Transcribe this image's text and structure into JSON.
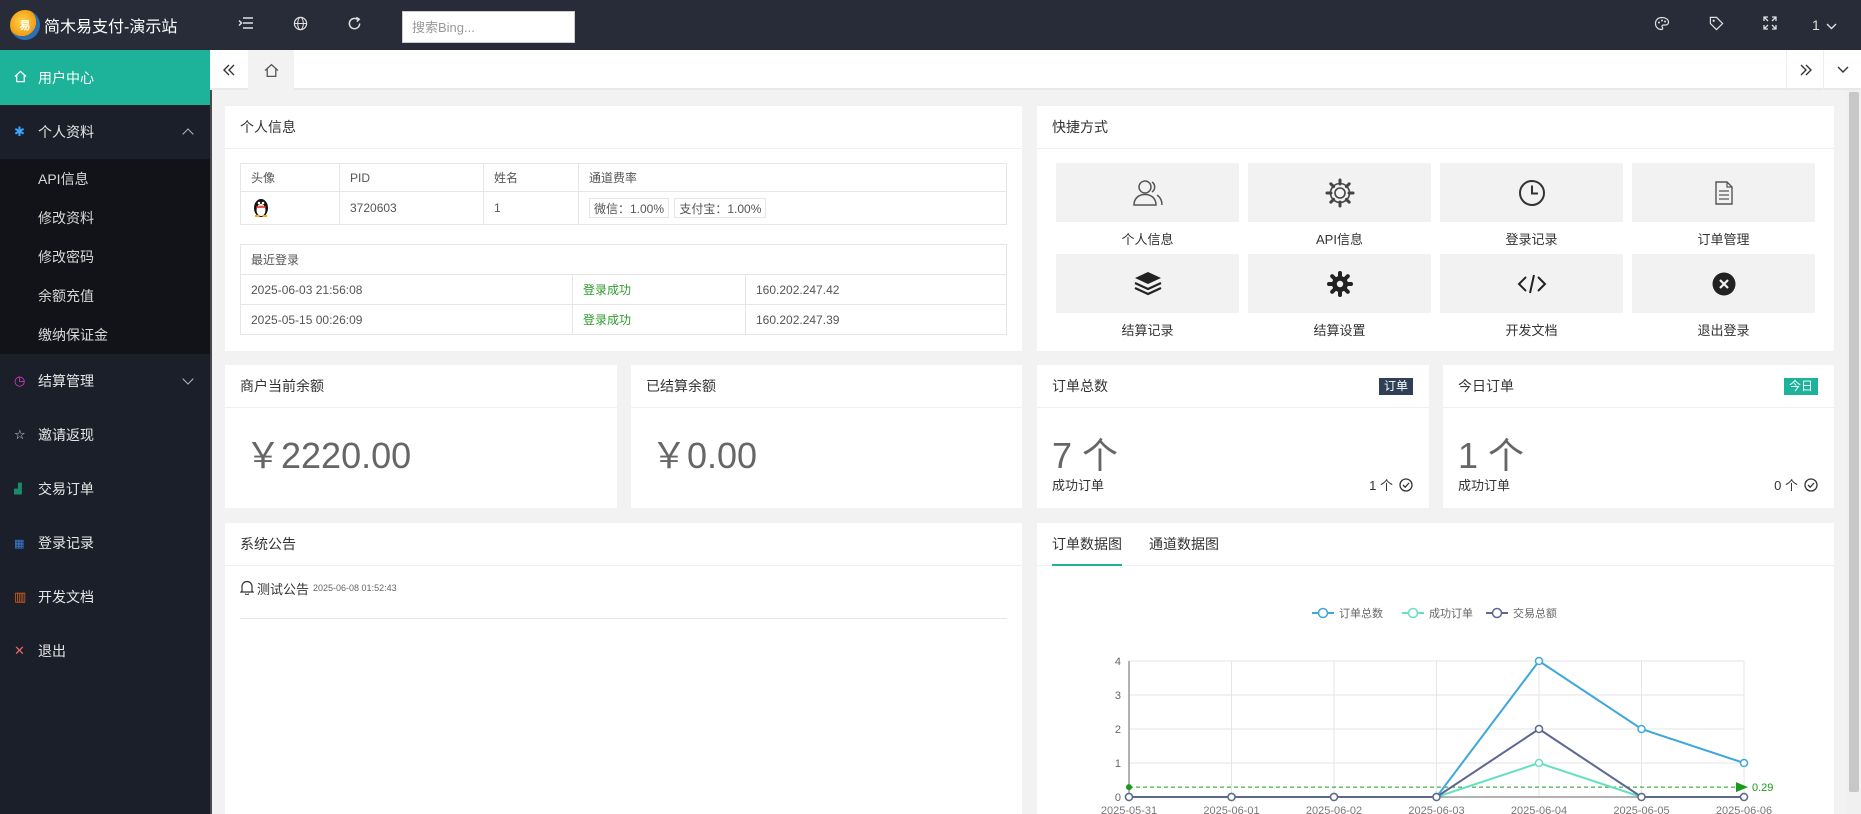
{
  "brand": {
    "name": "简木易支付-演示站",
    "logo_text": "易"
  },
  "sidebar": {
    "user_center": "用户中心",
    "profile": "个人资料",
    "profile_sub": [
      "API信息",
      "修改资料",
      "修改密码",
      "余额充值",
      "缴纳保证金"
    ],
    "settlement": "结算管理",
    "invite": "邀请返现",
    "orders": "交易订单",
    "login_log": "登录记录",
    "dev_docs": "开发文档",
    "logout": "退出"
  },
  "topbar": {
    "search_placeholder": "搜索Bing...",
    "user_label": "1"
  },
  "personal": {
    "title": "个人信息",
    "headers": [
      "头像",
      "PID",
      "姓名",
      "通道费率"
    ],
    "pid": "3720603",
    "name": "1",
    "rates": [
      "微信：1.00%",
      "支付宝：1.00%"
    ],
    "recent_login_title": "最近登录",
    "logins": [
      {
        "time": "2025-06-03 21:56:08",
        "status": "登录成功",
        "ip": "160.202.247.42"
      },
      {
        "time": "2025-05-15 00:26:09",
        "status": "登录成功",
        "ip": "160.202.247.39"
      }
    ]
  },
  "shortcuts": {
    "title": "快捷方式",
    "items": [
      "个人信息",
      "API信息",
      "登录记录",
      "订单管理",
      "结算记录",
      "结算设置",
      "开发文档",
      "退出登录"
    ]
  },
  "stats": {
    "balance_title": "商户当前余额",
    "balance": "￥2220.00",
    "settled_title": "已结算余额",
    "settled": "￥0.00",
    "total_orders_title": "订单总数",
    "total_orders_badge": "订单",
    "total_orders": "7 个",
    "total_success_label": "成功订单",
    "total_success": "1 个",
    "today_title": "今日订单",
    "today_badge": "今日",
    "today_orders": "1 个",
    "today_success_label": "成功订单",
    "today_success": "0 个",
    "badge_dark": "#2f4056",
    "badge_teal": "#1cb39a"
  },
  "notice": {
    "title": "系统公告",
    "item": "测试公告",
    "time": "2025-06-08 01:52:43"
  },
  "chart_tabs": [
    "订单数据图",
    "通道数据图"
  ],
  "chart_data": {
    "type": "line",
    "x": [
      "2025-05-31",
      "2025-06-01",
      "2025-06-02",
      "2025-06-03",
      "2025-06-04",
      "2025-06-05",
      "2025-06-06"
    ],
    "series": [
      {
        "name": "订单总数",
        "color": "#3fa7dc",
        "values": [
          0,
          0,
          0,
          0,
          4,
          2,
          1
        ]
      },
      {
        "name": "成功订单",
        "color": "#67e0c2",
        "values": [
          0,
          0,
          0,
          0,
          1,
          0,
          0
        ]
      },
      {
        "name": "交易总额",
        "color": "#5d6790",
        "values": [
          0,
          0,
          0,
          0,
          2,
          0,
          0
        ]
      }
    ],
    "avg_line": {
      "value": 0.29,
      "label": "0.29",
      "color": "#1a9a1a"
    },
    "ylim": [
      0,
      4
    ],
    "yticks": [
      0,
      1,
      2,
      3,
      4
    ],
    "legend": "top-center",
    "grid": true
  }
}
